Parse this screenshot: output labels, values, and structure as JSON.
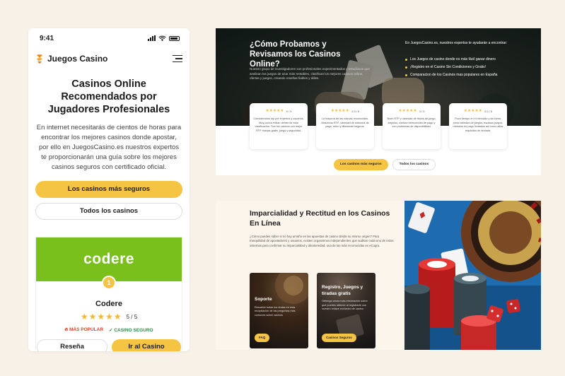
{
  "colors": {
    "background": "#f7f1e8",
    "accent": "#f6c443",
    "brand_green": "#79c01c",
    "popular": "#d4452c",
    "safe": "#2e8b47"
  },
  "mobile": {
    "status_bar": {
      "time": "9:41"
    },
    "header": {
      "brand_name": "Juegos Casino",
      "logo_icon": "juegoscasino-logo-icon",
      "menu_icon": "hamburger-menu-icon"
    },
    "hero": {
      "title": "Casinos Online Recomendados por Jugadores Profesionales",
      "text": "En internet necesitarás de cientos de horas para encontrar los mejores casinos donde apostar, por ello en JuegosCasino.es nuestros expertos te proporcionarán una guía sobre los mejores casinos seguros con certificado oficial.",
      "primary_button": "Los casinos más seguros",
      "secondary_button": "Todos los casinos"
    },
    "casino_card": {
      "logo_text": "codere",
      "rank": "1",
      "name": "Codere",
      "stars": "★★★★★",
      "rating": "5 / 5",
      "tag_popular": "MÁS POPULAR",
      "tag_safe": "CASINO SEGURO",
      "review_button": "Reseña",
      "go_button": "Ir al Casino"
    }
  },
  "desktop_top": {
    "title": "¿Cómo Probamos y Revisamos los Casinos Online?",
    "intro": "Nuestro grupo de investigadores son profesionales experimentados y estudiosos que analizan los juegos de azar más rentables, clasifican los mejores casinos online, ofertas y juegos, creando reseñas fiables y útiles.",
    "right_lead": "En JuegosCasino.es, nuestros expertos te ayudarán a encontrar:",
    "bullets": [
      "Los Juegos de casino donde es más fácil ganar dinero",
      "¡Registro en el Casino Sin Condiciones y Gratis!",
      "Comparacion de los Casinos mas populares en España"
    ],
    "review_cards": [
      {
        "stars": "★★★★★",
        "score": "5 / 5",
        "text": "Considerados top por expertos y usuarios. Muy pocos entran dentro de esta clasificación. Son los casinos con mejor RTP, tiradas gratis, juego y seguridad."
      },
      {
        "stars": "★★★★★",
        "score": "4.5 / 5",
        "text": "La mayoría de las marcas reconocidas. Atractivos RTP, variedad de métodos de pago, retiro y altamente seguros."
      },
      {
        "stars": "★★★★★",
        "score": "4 / 5",
        "text": "Buen RTP y variedad de títulos de juego, seguros, ciertas restricciones de pago y con problemas de disponibilidad."
      },
      {
        "stars": "★★★★★",
        "score": "3.5 / 5",
        "text": "Poco tiempo en el mercado y sin fama, poca variedad de juegos, escasos juegos, métodos de pago limitados así como altos requisitos de entrada."
      }
    ],
    "primary_button": "Los casinos más seguros",
    "secondary_button": "Todos los casinos"
  },
  "desktop_bottom": {
    "title": "Imparcialidad y Rectitud en los Casinos En Línea",
    "intro": "¿Cómo puedes saber si no hay amaño en las apuestas de casino desde su mismo origen? Para tranquilidad de apostadores y usuarios, existen organismos independientes que auditan cada uno de estos sistemas para confirmar su imparcialidad y aleatoriedad, una de las más reconocidas es eCogra.",
    "tiles": [
      {
        "title": "Soporte",
        "text": "Resuelve todas tus dudas en esta recopilación de las preguntas más comunes sobre casinos",
        "button": "FAQ"
      },
      {
        "title": "Registro, Juegos y tiradas gratis",
        "text": "Obtenga ahora más información sobre qué puedes obtener al registrarte con nuestro enlace exclusivo de casino",
        "button": "Casinos Seguros"
      }
    ]
  }
}
